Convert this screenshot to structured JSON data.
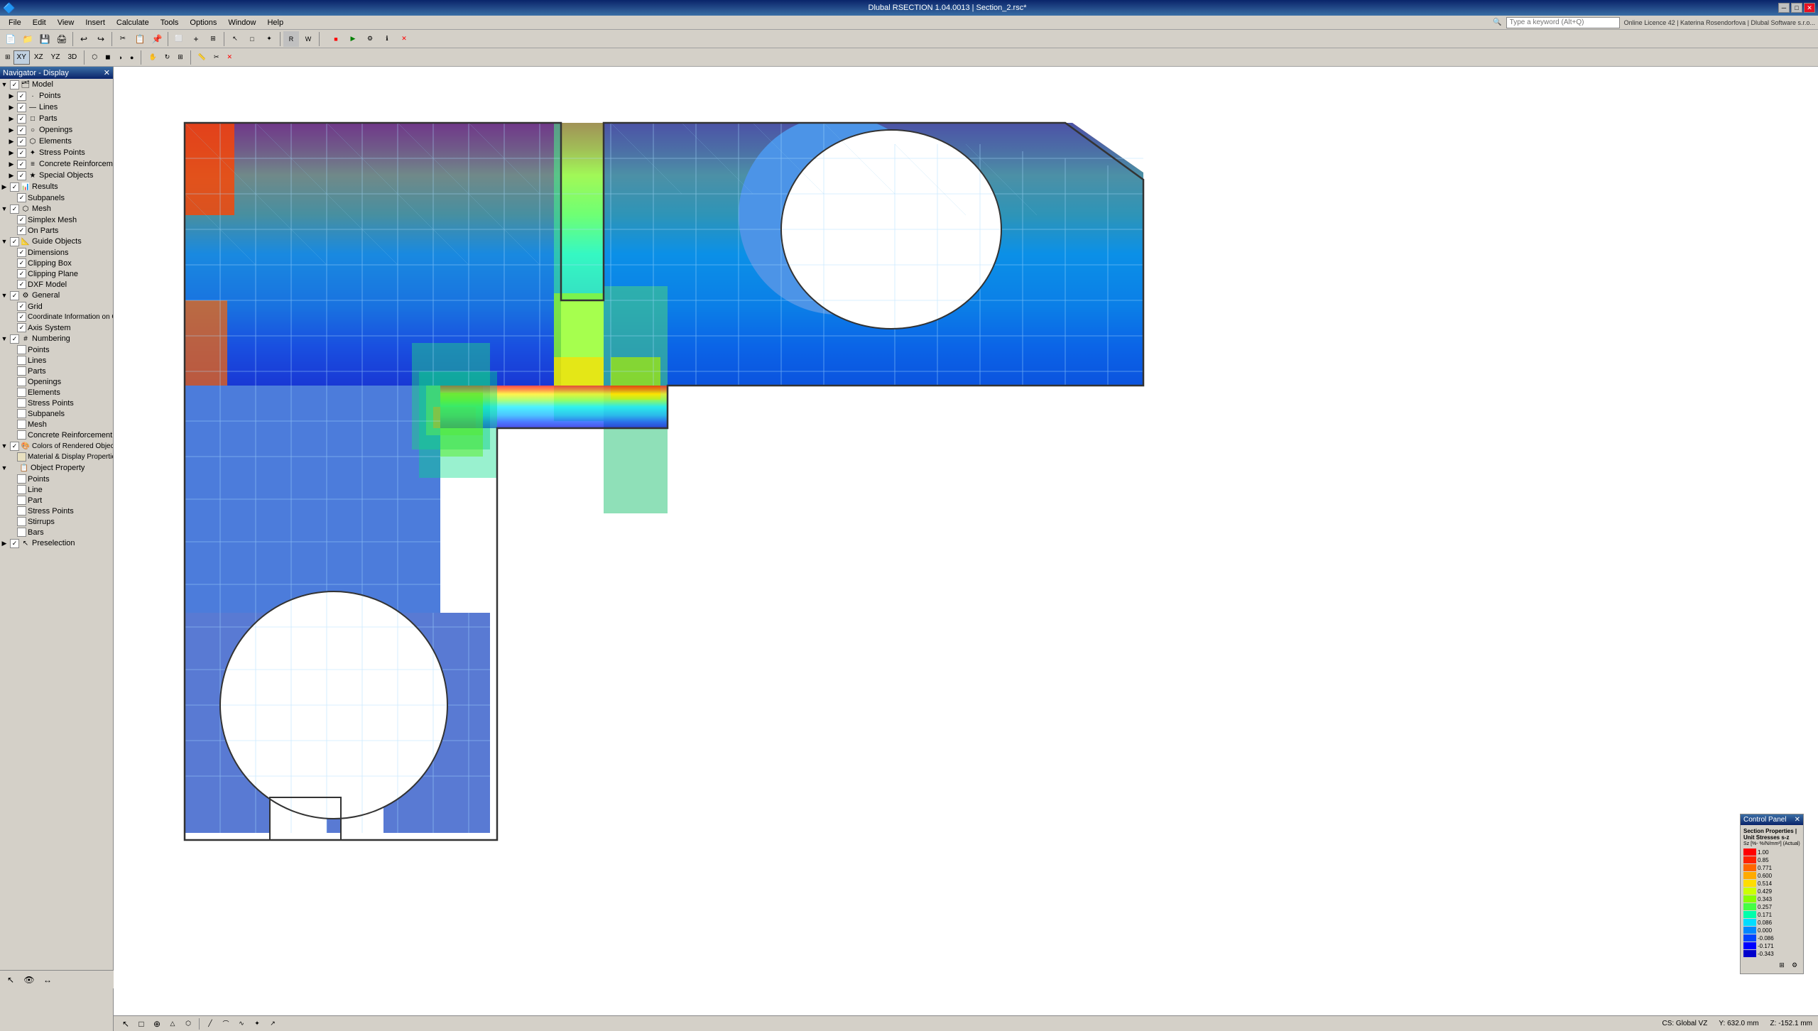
{
  "titleBar": {
    "title": "Dlubal RSECTION 1.04.0013 | Section_2.rsc*",
    "minimizeLabel": "─",
    "maximizeLabel": "□",
    "closeLabel": "✕"
  },
  "menuBar": {
    "items": [
      "File",
      "Edit",
      "View",
      "Insert",
      "Calculate",
      "Tools",
      "Options",
      "Window",
      "Help"
    ]
  },
  "toolbar1": {
    "buttons": [
      "📁",
      "💾",
      "🖨",
      "↩",
      "↪",
      "📋",
      "🔍"
    ],
    "searchPlaceholder": "Type a keyword (Alt+Q)",
    "licenseInfo": "Online Licence 42 | Katerina Rosendorfova | Dlubal Software s.r.o..."
  },
  "toolbar2": {
    "viewButtons": [
      "",
      "XY",
      "XZ",
      "YZ",
      "3D"
    ],
    "zoomButtons": [
      "+",
      "-",
      "⊞"
    ],
    "renderButtons": [
      "Mesh",
      "Fill",
      "Shade"
    ]
  },
  "navigator": {
    "title": "Navigator - Display",
    "tree": [
      {
        "id": "model",
        "label": "Model",
        "level": 0,
        "checked": true,
        "expanded": true,
        "hasCheck": true
      },
      {
        "id": "points",
        "label": "Points",
        "level": 1,
        "checked": true,
        "hasCheck": true
      },
      {
        "id": "lines",
        "label": "Lines",
        "level": 1,
        "checked": true,
        "hasCheck": true
      },
      {
        "id": "parts",
        "label": "Parts",
        "level": 1,
        "checked": true,
        "hasCheck": true
      },
      {
        "id": "openings",
        "label": "Openings",
        "level": 1,
        "checked": true,
        "hasCheck": true
      },
      {
        "id": "elements",
        "label": "Elements",
        "level": 1,
        "checked": true,
        "hasCheck": true
      },
      {
        "id": "stress-points",
        "label": "Stress Points",
        "level": 1,
        "checked": true,
        "hasCheck": true
      },
      {
        "id": "concrete-reinf",
        "label": "Concrete Reinforcement",
        "level": 1,
        "checked": true,
        "hasCheck": true
      },
      {
        "id": "special-objects",
        "label": "Special Objects",
        "level": 1,
        "checked": true,
        "hasCheck": true
      },
      {
        "id": "results",
        "label": "Results",
        "level": 0,
        "checked": true,
        "expanded": false,
        "hasCheck": true
      },
      {
        "id": "subpanels",
        "label": "Subpanels",
        "level": 1,
        "checked": true,
        "hasCheck": true
      },
      {
        "id": "mesh",
        "label": "Mesh",
        "level": 0,
        "checked": true,
        "expanded": true,
        "hasCheck": true
      },
      {
        "id": "simplex-mesh",
        "label": "Simplex Mesh",
        "level": 1,
        "checked": true,
        "hasCheck": true
      },
      {
        "id": "on-parts",
        "label": "On Parts",
        "level": 1,
        "checked": true,
        "hasCheck": true
      },
      {
        "id": "guide-objects",
        "label": "Guide Objects",
        "level": 0,
        "checked": true,
        "expanded": true,
        "hasCheck": true
      },
      {
        "id": "dimensions",
        "label": "Dimensions",
        "level": 1,
        "checked": true,
        "hasCheck": true
      },
      {
        "id": "clipping-box",
        "label": "Clipping Box",
        "level": 1,
        "checked": true,
        "hasCheck": true
      },
      {
        "id": "clipping-plane",
        "label": "Clipping Plane",
        "level": 1,
        "checked": true,
        "hasCheck": true
      },
      {
        "id": "dxf-model",
        "label": "DXF Model",
        "level": 1,
        "checked": true,
        "hasCheck": true
      },
      {
        "id": "general",
        "label": "General",
        "level": 0,
        "checked": true,
        "expanded": true,
        "hasCheck": true
      },
      {
        "id": "grid",
        "label": "Grid",
        "level": 1,
        "checked": true,
        "hasCheck": true
      },
      {
        "id": "coord-info",
        "label": "Coordinate Information on Cursor",
        "level": 1,
        "checked": true,
        "hasCheck": true
      },
      {
        "id": "axis-system",
        "label": "Axis System",
        "level": 1,
        "checked": true,
        "hasCheck": true
      },
      {
        "id": "numbering",
        "label": "Numbering",
        "level": 0,
        "checked": true,
        "expanded": true,
        "hasCheck": true
      },
      {
        "id": "num-points",
        "label": "Points",
        "level": 1,
        "checked": false,
        "hasCheck": true
      },
      {
        "id": "num-lines",
        "label": "Lines",
        "level": 1,
        "checked": false,
        "hasCheck": true
      },
      {
        "id": "num-parts",
        "label": "Parts",
        "level": 1,
        "checked": false,
        "hasCheck": true
      },
      {
        "id": "num-openings",
        "label": "Openings",
        "level": 1,
        "checked": false,
        "hasCheck": true
      },
      {
        "id": "num-elements",
        "label": "Elements",
        "level": 1,
        "checked": false,
        "hasCheck": true
      },
      {
        "id": "num-stress",
        "label": "Stress Points",
        "level": 1,
        "checked": false,
        "hasCheck": true
      },
      {
        "id": "num-subpanels",
        "label": "Subpanels",
        "level": 1,
        "checked": false,
        "hasCheck": true
      },
      {
        "id": "num-mesh",
        "label": "Mesh",
        "level": 1,
        "checked": false,
        "hasCheck": true
      },
      {
        "id": "num-conc-reinf",
        "label": "Concrete Reinforcement",
        "level": 1,
        "checked": false,
        "hasCheck": true
      },
      {
        "id": "colors-rendered",
        "label": "Colors of Rendered Objects by",
        "level": 0,
        "checked": true,
        "expanded": true,
        "hasCheck": true
      },
      {
        "id": "mat-display",
        "label": "Material & Display Properties",
        "level": 1,
        "checked": false,
        "hasCheck": true
      },
      {
        "id": "object-property",
        "label": "Object Property",
        "level": 0,
        "checked": true,
        "expanded": true,
        "hasCheck": false
      },
      {
        "id": "op-points",
        "label": "Points",
        "level": 1,
        "checked": false,
        "hasCheck": true
      },
      {
        "id": "op-line",
        "label": "Line",
        "level": 1,
        "checked": false,
        "hasCheck": true
      },
      {
        "id": "op-part",
        "label": "Part",
        "level": 1,
        "checked": false,
        "hasCheck": true
      },
      {
        "id": "op-stress",
        "label": "Stress Points",
        "level": 1,
        "checked": false,
        "hasCheck": true
      },
      {
        "id": "op-stirrups",
        "label": "Stirrups",
        "level": 1,
        "checked": false,
        "hasCheck": true
      },
      {
        "id": "op-bars",
        "label": "Bars",
        "level": 1,
        "checked": false,
        "hasCheck": true
      },
      {
        "id": "preselection",
        "label": "Preselection",
        "level": 0,
        "checked": true,
        "expanded": false,
        "hasCheck": true
      }
    ]
  },
  "controlPanel": {
    "title": "Control Panel",
    "closeLabel": "✕",
    "subtitle": "Section Properties | Unit Stresses s-z",
    "subtitle2": "Sz [%- %/N/mm²] (Actual)",
    "legend": [
      {
        "color": "#FF0000",
        "value": "1.00"
      },
      {
        "color": "#FF2200",
        "value": "0.85"
      },
      {
        "color": "#FF6600",
        "value": "0.771"
      },
      {
        "color": "#FFAA00",
        "value": "0.600"
      },
      {
        "color": "#FFDD00",
        "value": "0.514"
      },
      {
        "color": "#CCFF00",
        "value": "0.429"
      },
      {
        "color": "#88FF00",
        "value": "0.343"
      },
      {
        "color": "#44FF44",
        "value": "0.257"
      },
      {
        "color": "#00FFAA",
        "value": "0.171"
      },
      {
        "color": "#00DDFF",
        "value": "0.086"
      },
      {
        "color": "#0088FF",
        "value": "0.000"
      },
      {
        "color": "#0044FF",
        "value": "-0.086"
      },
      {
        "color": "#0000FF",
        "value": "-0.171"
      },
      {
        "color": "#0000CC",
        "value": "-0.343"
      }
    ]
  },
  "statusBar": {
    "cs": "CS: Global VZ",
    "x": "Y: 632.0 mm",
    "z": "Z: -152.1 mm"
  },
  "bottomToolbar": {
    "icons": [
      "↖",
      "□",
      "⊕",
      "◎",
      "△",
      "⬡",
      "◻",
      "╱",
      "⌒",
      "∿",
      "⌒",
      "↗",
      "✦",
      "⬜",
      "◯",
      "⬜",
      "✏",
      "⬜",
      "⬜",
      "⬜"
    ]
  }
}
